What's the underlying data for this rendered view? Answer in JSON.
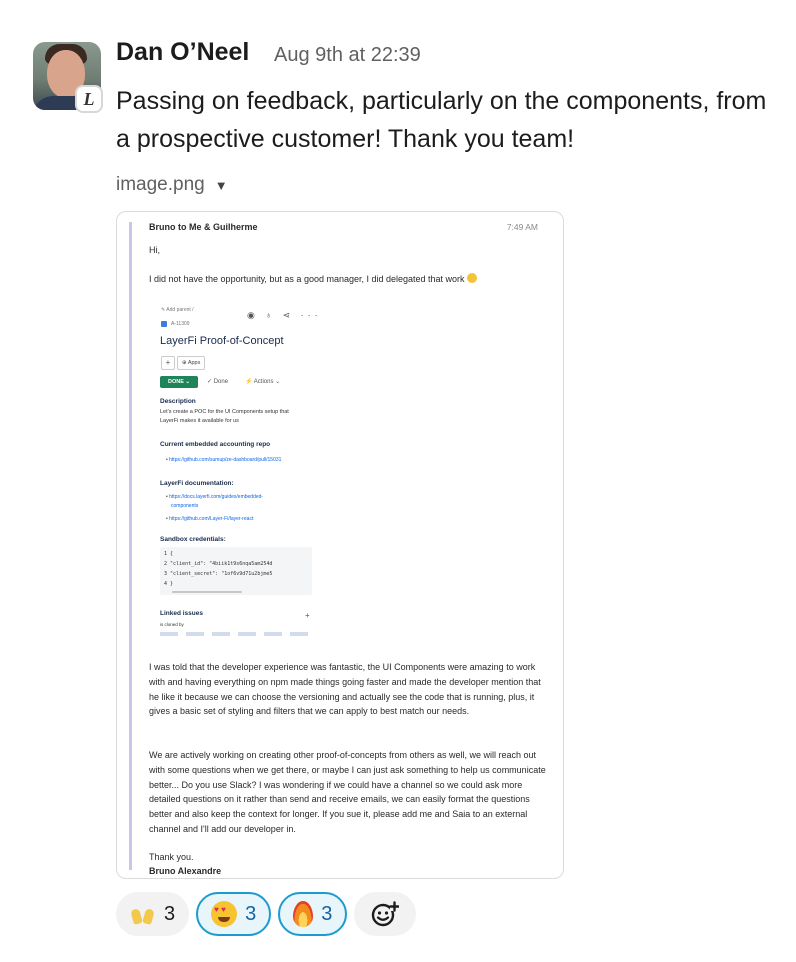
{
  "message": {
    "author": "Dan O’Neel",
    "timestamp": "Aug 9th at 22:39",
    "badge": "L",
    "text": "Passing on feedback, particularly on the components, from a prospective customer! Thank you team!",
    "attachment_name": "image.png"
  },
  "email": {
    "from": "Bruno to Me & Guilherme",
    "time": "7:49 AM",
    "greeting": "Hi,",
    "p1": "I did not have the opportunity, but as a good manager, I did delegated that work",
    "ticket": {
      "parent": "✎ Add parent  /",
      "id": "A-11309",
      "title": "LayerFi Proof-of-Concept",
      "apps": "⊕ Apps",
      "status": "DONE ⌄",
      "done": "✓ Done",
      "actions": "⚡ Actions ⌄",
      "description_h": "Description",
      "description_1": "Let's create a POC for the UI Components setup that",
      "description_2": "LayerFi makes it available for us",
      "repo_h": "Current embedded accounting repo",
      "repo_link": "https://github.com/sumup/ze-dashboard/pull/15031",
      "docs_h": "LayerFi documentation:",
      "docs_link_1": "https://docs.layerfi.com/guides/embedded-",
      "docs_link_1b": "components",
      "docs_link_2": "https://github.com/Layer-Fi/layer-react",
      "sandbox_h": "Sandbox credentials:",
      "code": [
        "1 {",
        "2        \"client_id\": \"4biik1t9s6nqa5am254d",
        "3        \"client_secret\": \"1of6v9d71u2bjme5",
        "4 }"
      ],
      "linked_h": "Linked issues",
      "linked_sub": "is cloned by"
    },
    "p2": "I was told that the developer experience was fantastic, the UI Components were amazing to work with and having everything on npm made things going faster and made the developer mention that he like it because we can choose the versioning and actually see the code that is running, plus, it gives a basic set of styling and filters that we can apply to best match our needs.",
    "p3": "We are actively working on creating other proof-of-concepts from others as well, we will reach out with some questions when we get there, or maybe I can just ask something to help us communicate better... Do you use Slack? I was wondering if we could have a channel so we could ask more detailed questions on it rather than send and receive emails, we can easily format the questions better and also keep the context for longer. If you sue it, please add me and Saia to an external channel and I'll add our developer in.",
    "thanks": "Thank you.",
    "signature": "Bruno Alexandre"
  },
  "reactions": [
    {
      "icon": "raised-hands-icon",
      "count": "3",
      "selected": false
    },
    {
      "icon": "heart-eyes-icon",
      "count": "3",
      "selected": true
    },
    {
      "icon": "fire-icon",
      "count": "3",
      "selected": true
    }
  ],
  "colors": {
    "selected_border": "#1d9bd1",
    "selected_bg": "#e8f5fa",
    "done_green": "#1f845a"
  }
}
